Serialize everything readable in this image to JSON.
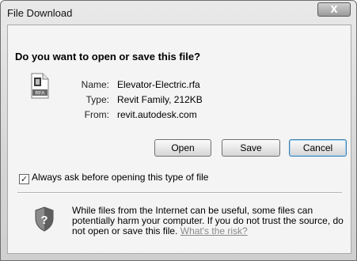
{
  "window": {
    "title": "File Download",
    "close_label": "X"
  },
  "dialog": {
    "question": "Do you want to open or save this file?",
    "file": {
      "icon_label": "RFA",
      "name_label": "Name:",
      "name_value": "Elevator-Electric.rfa",
      "type_label": "Type:",
      "type_value": "Revit Family, 212KB",
      "from_label": "From:",
      "from_value": "revit.autodesk.com"
    },
    "buttons": {
      "open": "Open",
      "save": "Save",
      "cancel": "Cancel"
    },
    "always_ask": {
      "checked": true,
      "label": "Always ask before opening this type of file"
    },
    "warning": {
      "text": "While files from the Internet can be useful, some files can potentially harm your computer. If you do not trust the source, do not open or save this file. ",
      "link": "What's the risk?"
    }
  },
  "icons": {
    "file": "file-icon",
    "shield": "shield-icon",
    "close": "close-icon",
    "check": "check-icon"
  }
}
